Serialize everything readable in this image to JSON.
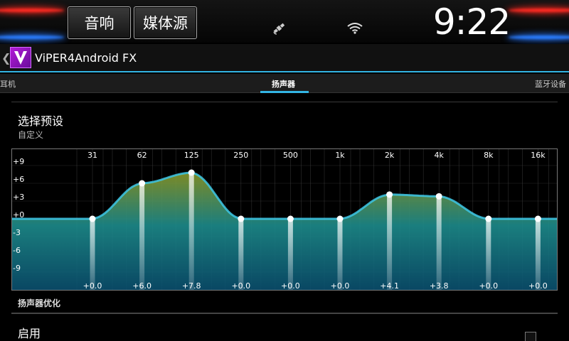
{
  "statusbar": {
    "audio_button": "音响",
    "media_source_button": "媒体源",
    "clock": "9:22"
  },
  "appbar": {
    "title": "ViPER4Android FX",
    "logo_letter": "V"
  },
  "tabs": [
    {
      "label": "耳机",
      "active": false
    },
    {
      "label": "扬声器",
      "active": true
    },
    {
      "label": "蓝牙设备",
      "active": false
    }
  ],
  "preset": {
    "title": "选择预设",
    "summary": "自定义"
  },
  "equalizer": {
    "y_ticks": [
      "+9",
      "+6",
      "+3",
      "+0",
      "-3",
      "-6",
      "-9"
    ],
    "bands": [
      {
        "freq": "31",
        "gain": 0.0,
        "label": "+0.0"
      },
      {
        "freq": "62",
        "gain": 6.0,
        "label": "+6.0"
      },
      {
        "freq": "125",
        "gain": 7.8,
        "label": "+7.8"
      },
      {
        "freq": "250",
        "gain": 0.0,
        "label": "+0.0"
      },
      {
        "freq": "500",
        "gain": 0.0,
        "label": "+0.0"
      },
      {
        "freq": "1k",
        "gain": 0.0,
        "label": "+0.0"
      },
      {
        "freq": "2k",
        "gain": 4.1,
        "label": "+4.1"
      },
      {
        "freq": "4k",
        "gain": 3.8,
        "label": "+3.8"
      },
      {
        "freq": "8k",
        "gain": 0.0,
        "label": "+0.0"
      },
      {
        "freq": "16k",
        "gain": 0.0,
        "label": "+0.0"
      }
    ],
    "colors": {
      "fill_top": "#8a9a2a",
      "fill_mid": "#1d8c8c",
      "fill_bottom": "#0a4f6e",
      "line": "#3ec8e8"
    }
  },
  "speaker_opt": {
    "category": "扬声器优化",
    "enable_title": "启用"
  }
}
